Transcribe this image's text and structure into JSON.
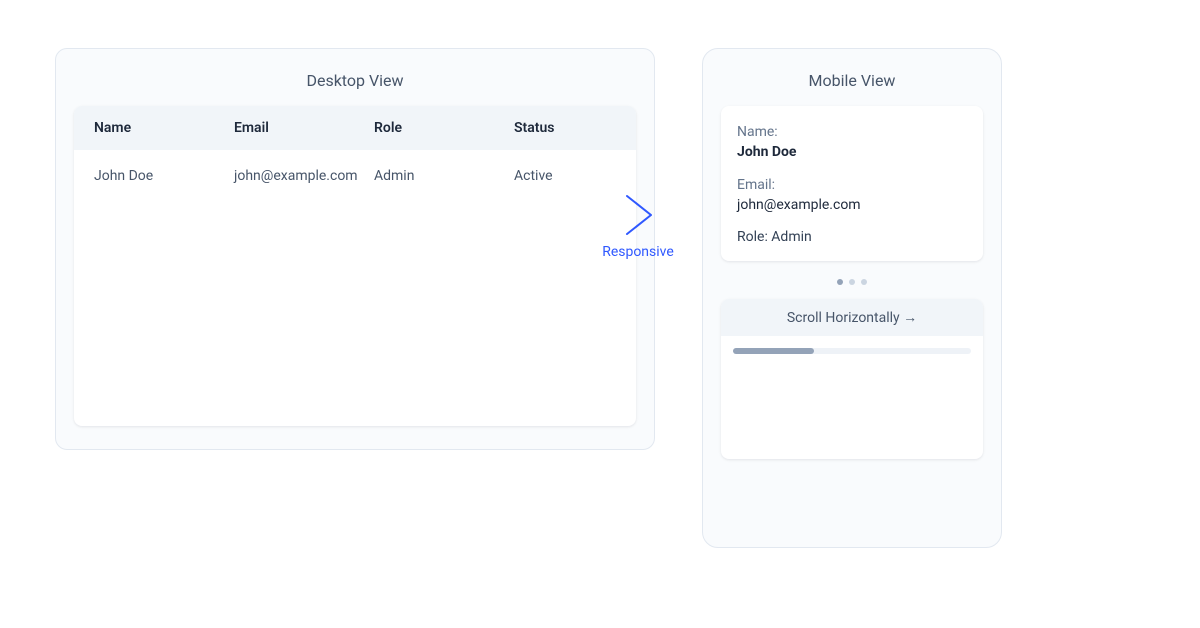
{
  "desktop": {
    "title": "Desktop View",
    "headers": {
      "name": "Name",
      "email": "Email",
      "role": "Role",
      "status": "Status"
    },
    "row": {
      "name": "John Doe",
      "email": "john@example.com",
      "role": "Admin",
      "status": "Active"
    }
  },
  "arrow": {
    "label": "Responsive"
  },
  "mobile": {
    "title": "Mobile View",
    "labels": {
      "name": "Name:",
      "email": "Email:",
      "role": "Role:"
    },
    "values": {
      "name": "John Doe",
      "email": "john@example.com",
      "role": "Admin"
    },
    "role_line": "Role: Admin",
    "scroll_title": "Scroll Horizontally →"
  }
}
